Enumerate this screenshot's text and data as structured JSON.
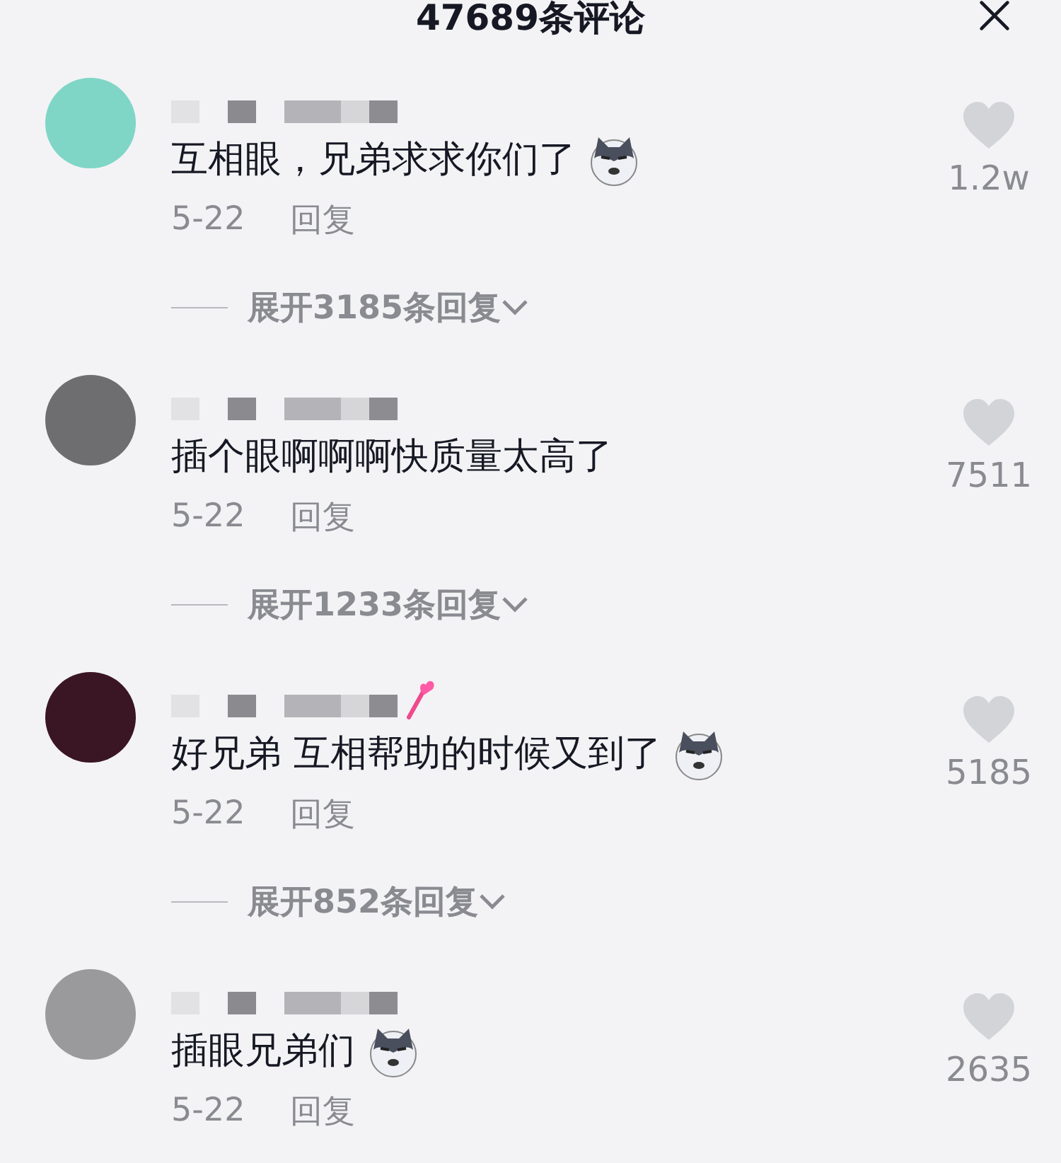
{
  "header": {
    "title": "47689条评论"
  },
  "comments": [
    {
      "text": "互相眼，兄弟求求你们了",
      "emoji": true,
      "badge": false,
      "date": "5-22",
      "reply": "回复",
      "likes": "1.2w",
      "replies": "展开3185条回复"
    },
    {
      "text": "插个眼啊啊啊快质量太高了",
      "emoji": false,
      "badge": false,
      "date": "5-22",
      "reply": "回复",
      "likes": "7511",
      "replies": "展开1233条回复"
    },
    {
      "text": "好兄弟 互相帮助的时候又到了",
      "emoji": true,
      "badge": true,
      "date": "5-22",
      "reply": "回复",
      "likes": "5185",
      "replies": "展开852条回复"
    },
    {
      "text": "插眼兄弟们",
      "emoji": true,
      "badge": false,
      "date": "5-22",
      "reply": "回复",
      "likes": "2635"
    }
  ]
}
